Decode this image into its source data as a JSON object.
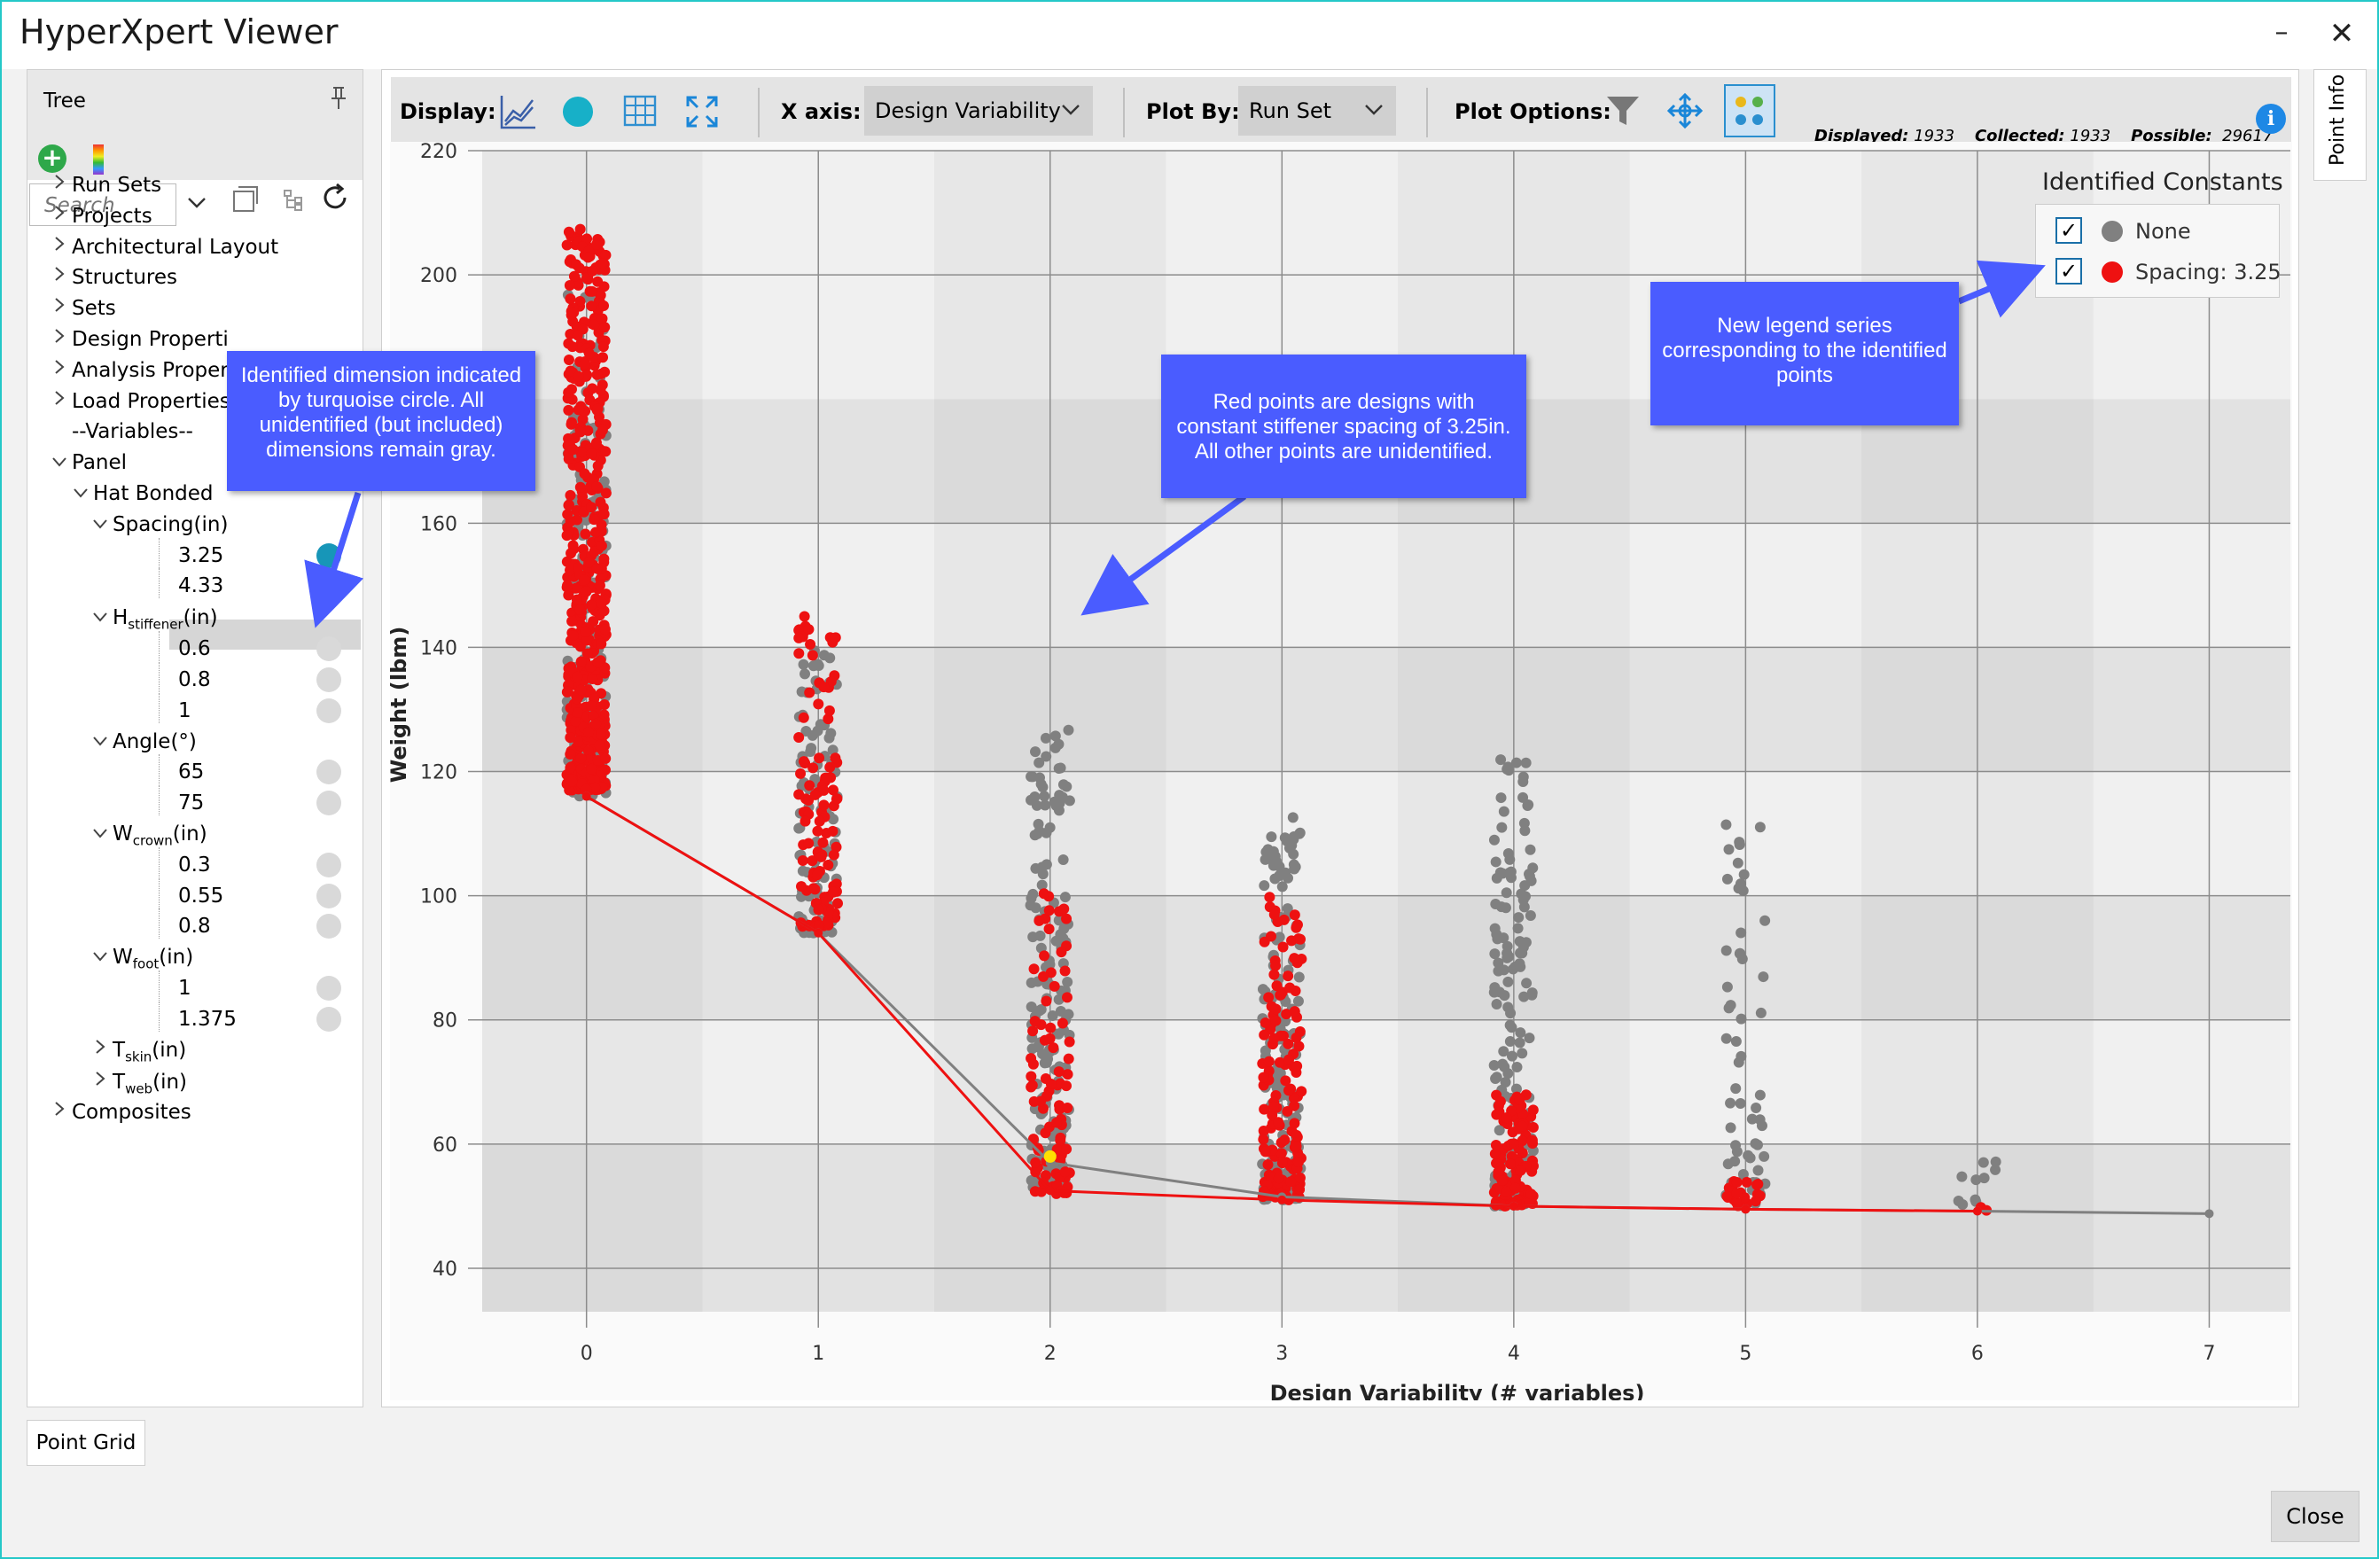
{
  "window": {
    "title": "HyperXpert Viewer",
    "minimize": "–",
    "close": "✕"
  },
  "tree": {
    "title": "Tree",
    "pin": "📌",
    "search_placeholder": "Search",
    "items": [
      {
        "label": "Run Sets"
      },
      {
        "label": "Projects"
      },
      {
        "label": "Architectural Layout"
      },
      {
        "label": "Structures"
      },
      {
        "label": "Sets"
      },
      {
        "label": "Design Properti"
      },
      {
        "label": "Analysis Propert"
      },
      {
        "label": "Load Properties"
      },
      {
        "label": "--Variables--"
      },
      {
        "label": "Panel"
      },
      {
        "label": "Hat Bonded"
      },
      {
        "label": "Spacing(in)"
      },
      {
        "label": "3.25"
      },
      {
        "label": "4.33"
      },
      {
        "label": "H",
        "sub": "stiffener",
        "suffix": "(in)"
      },
      {
        "label": "0.6"
      },
      {
        "label": "0.8"
      },
      {
        "label": "1"
      },
      {
        "label": "Angle(°)"
      },
      {
        "label": "65"
      },
      {
        "label": "75"
      },
      {
        "label": "W",
        "sub": "crown",
        "suffix": "(in)"
      },
      {
        "label": "0.3"
      },
      {
        "label": "0.55"
      },
      {
        "label": "0.8"
      },
      {
        "label": "W",
        "sub": "foot",
        "suffix": "(in)"
      },
      {
        "label": "1"
      },
      {
        "label": "1.375"
      },
      {
        "label": "T",
        "sub": "skin",
        "suffix": "(in)"
      },
      {
        "label": "T",
        "sub": "web",
        "suffix": "(in)"
      },
      {
        "label": "Composites"
      }
    ]
  },
  "point_grid_tab": "Point Grid",
  "point_info_tab": "Point Info",
  "toolbar": {
    "display_label": "Display:",
    "xaxis_label": "X axis:",
    "xaxis_value": "Design Variability",
    "plotby_label": "Plot By:",
    "plotby_value": "Run Set",
    "plot_options_label": "Plot Options:",
    "displayed_label": "Displayed:",
    "displayed_value": "1933",
    "collected_label": "Collected:",
    "collected_value": "1933",
    "possible_label": "Possible:",
    "possible_value": "29617"
  },
  "legend": {
    "title": "Identified Constants",
    "items": [
      {
        "label": "None",
        "color": "#808080",
        "checked": true
      },
      {
        "label": "Spacing: 3.25",
        "color": "#ee1111",
        "checked": true
      }
    ]
  },
  "callouts": {
    "tree": "Identified dimension indicated by turquoise circle. All unidentified (but included) dimensions remain gray.",
    "red": "Red points are designs with constant stiffener spacing of 3.25in. All other points are unidentified.",
    "legend": "New legend series corresponding to the identified points"
  },
  "close_button": "Close",
  "chart_data": {
    "type": "scatter",
    "xlabel": "Design Variability (# variables)",
    "ylabel": "Weight (lbm)",
    "xlim": [
      -0.45,
      7.35
    ],
    "ylim": [
      33,
      220
    ],
    "x_ticks": [
      0,
      1,
      2,
      3,
      4,
      5,
      6,
      7
    ],
    "y_ticks": [
      40,
      60,
      80,
      100,
      120,
      140,
      160,
      200,
      220
    ],
    "colors": {
      "none": "#808080",
      "spacing": "#ee1111",
      "highlight": "#ffe000"
    },
    "series": [
      {
        "name": "None",
        "color": "#808080",
        "clusters": [
          {
            "x": 0,
            "ymin": 116,
            "ymax": 200,
            "count": 160
          },
          {
            "x": 1,
            "ymin": 94,
            "ymax": 140,
            "count": 90
          },
          {
            "x": 2,
            "ymin": 53,
            "ymax": 128,
            "count": 170
          },
          {
            "x": 3,
            "ymin": 51,
            "ymax": 113,
            "count": 170
          },
          {
            "x": 4,
            "ymin": 50,
            "ymax": 122,
            "count": 150
          },
          {
            "x": 5,
            "ymin": 50,
            "ymax": 113,
            "count": 60
          },
          {
            "x": 6,
            "ymin": 49,
            "ymax": 60,
            "count": 10
          }
        ],
        "frontier": [
          [
            0,
            116
          ],
          [
            1,
            94
          ],
          [
            2,
            57
          ],
          [
            3,
            51.5
          ],
          [
            4,
            50
          ],
          [
            5,
            49.5
          ],
          [
            6,
            49.2
          ],
          [
            7,
            48.8
          ]
        ]
      },
      {
        "name": "Spacing: 3.25",
        "color": "#ee1111",
        "clusters": [
          {
            "x": 0,
            "ymin": 117,
            "ymax": 208,
            "count": 520
          },
          {
            "x": 1,
            "ymin": 95,
            "ymax": 145,
            "count": 110
          },
          {
            "x": 2,
            "ymin": 52,
            "ymax": 102,
            "count": 90
          },
          {
            "x": 3,
            "ymin": 51,
            "ymax": 100,
            "count": 150
          },
          {
            "x": 4,
            "ymin": 50,
            "ymax": 68,
            "count": 110
          },
          {
            "x": 5,
            "ymin": 50,
            "ymax": 54,
            "count": 20
          },
          {
            "x": 6,
            "ymin": 49,
            "ymax": 50,
            "count": 2
          }
        ],
        "frontier": [
          [
            0,
            116
          ],
          [
            1,
            94
          ],
          [
            2,
            52.5
          ],
          [
            3,
            51
          ],
          [
            4,
            50
          ],
          [
            5,
            49.5
          ],
          [
            6,
            49.2
          ]
        ]
      }
    ]
  }
}
